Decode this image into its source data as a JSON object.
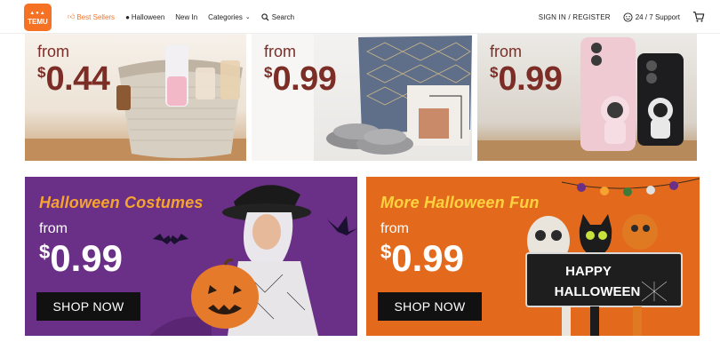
{
  "header": {
    "logo_text": "TEMU",
    "nav": [
      {
        "label": "Best Sellers",
        "icon": "thumbs-up-icon",
        "active": true
      },
      {
        "label": "Halloween",
        "icon": "pumpkin-icon"
      },
      {
        "label": "New In"
      },
      {
        "label": "Categories",
        "icon": "chevron-down-icon"
      },
      {
        "label": "Search",
        "icon": "search-icon"
      }
    ],
    "signin_label": "SIGN IN / REGISTER",
    "support_label": "24 / 7 Support",
    "cart_icon": "cart-icon"
  },
  "top_tiles": [
    {
      "from": "from",
      "currency": "$",
      "price": "0.44",
      "product": "woven storage basket"
    },
    {
      "from": "from",
      "currency": "$",
      "price": "0.99",
      "product": "pillows and slippers"
    },
    {
      "from": "from",
      "currency": "$",
      "price": "0.99",
      "product": "phone case with stand"
    }
  ],
  "halloween_banners": [
    {
      "headline": "Halloween Costumes",
      "from": "from",
      "currency": "$",
      "price": "0.99",
      "button": "SHOP NOW"
    },
    {
      "headline": "More Halloween Fun",
      "from": "from",
      "currency": "$",
      "price": "0.99",
      "button": "SHOP NOW",
      "sign_line1": "HAPPY",
      "sign_line2": "HALLOWEEN"
    }
  ],
  "colors": {
    "brand": "#f57224",
    "price_text": "#7b2d26",
    "banner1_bg": "#6a2f86",
    "banner2_bg": "#e36a1c",
    "headline1": "#f6a330",
    "headline2": "#ffd23f"
  }
}
